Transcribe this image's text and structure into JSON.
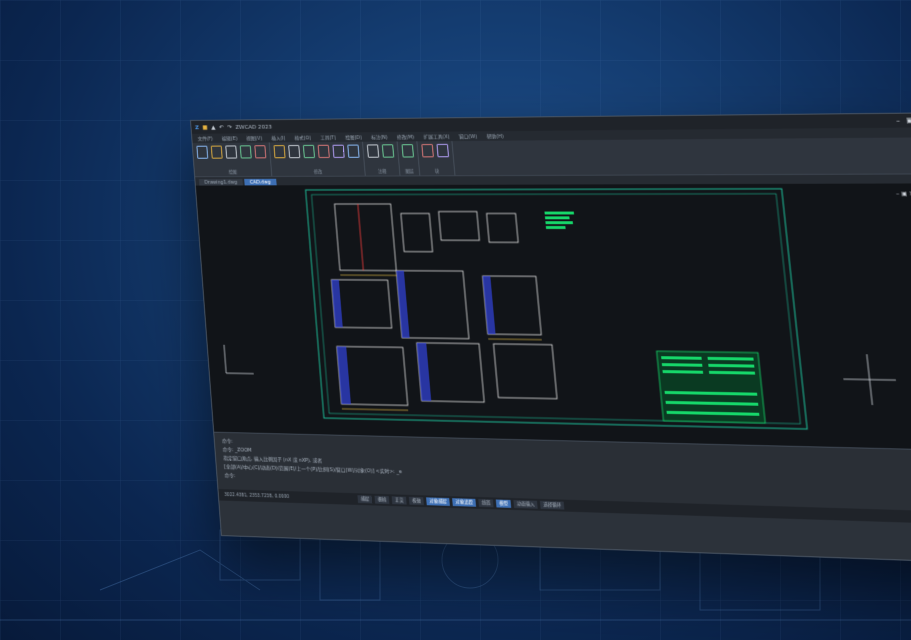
{
  "app": {
    "title": "ZWCAD 2023",
    "logo_text": "Z"
  },
  "menu": [
    "文件(F)",
    "编辑(E)",
    "视图(V)",
    "插入(I)",
    "格式(O)",
    "工具(T)",
    "绘图(D)",
    "标注(N)",
    "修改(M)",
    "扩展工具(X)",
    "窗口(W)",
    "帮助(H)"
  ],
  "ribbon_groups": [
    {
      "label": "绘图",
      "icons": [
        "line-icon",
        "polyline-icon",
        "circle-icon",
        "arc-icon",
        "rectangle-icon"
      ]
    },
    {
      "label": "修改",
      "icons": [
        "move-icon",
        "copy-icon",
        "rotate-icon",
        "mirror-icon",
        "trim-icon",
        "erase-icon"
      ]
    },
    {
      "label": "注释",
      "icons": [
        "text-icon",
        "dimension-icon"
      ]
    },
    {
      "label": "图层",
      "icons": [
        "layer-icon"
      ]
    },
    {
      "label": "块",
      "icons": [
        "block-icon",
        "insert-icon"
      ]
    }
  ],
  "tabs": [
    {
      "label": "Drawing1.dwg",
      "active": false
    },
    {
      "label": "CAD.dwg",
      "active": true
    }
  ],
  "command": {
    "lines": [
      "命令:",
      "命令: _ZOOM",
      "指定窗口角点, 输入比例因子 (nX 或 nXP), 或者",
      "[全部(A)/中心(C)/动态(D)/范围(E)/上一个(P)/比例(S)/窗口(W)/对象(O)] <实时>: _e"
    ],
    "prompt": "命令:"
  },
  "status": {
    "coordinates": "3022.4381, 2353.7238, 0.0000",
    "buttons": [
      {
        "label": "捕捉",
        "on": false
      },
      {
        "label": "栅格",
        "on": false
      },
      {
        "label": "正交",
        "on": false
      },
      {
        "label": "极轴",
        "on": false
      },
      {
        "label": "对象捕捉",
        "on": true
      },
      {
        "label": "对象追踪",
        "on": true
      },
      {
        "label": "线宽",
        "on": false
      },
      {
        "label": "模型",
        "on": true
      },
      {
        "label": "动态输入",
        "on": false
      },
      {
        "label": "选择循环",
        "on": false
      }
    ]
  },
  "colors": {
    "accent": "#3d6fb4",
    "drawing_frame": "#1fbf9a",
    "title_block": "#16d86a",
    "background": "#0b2650"
  }
}
